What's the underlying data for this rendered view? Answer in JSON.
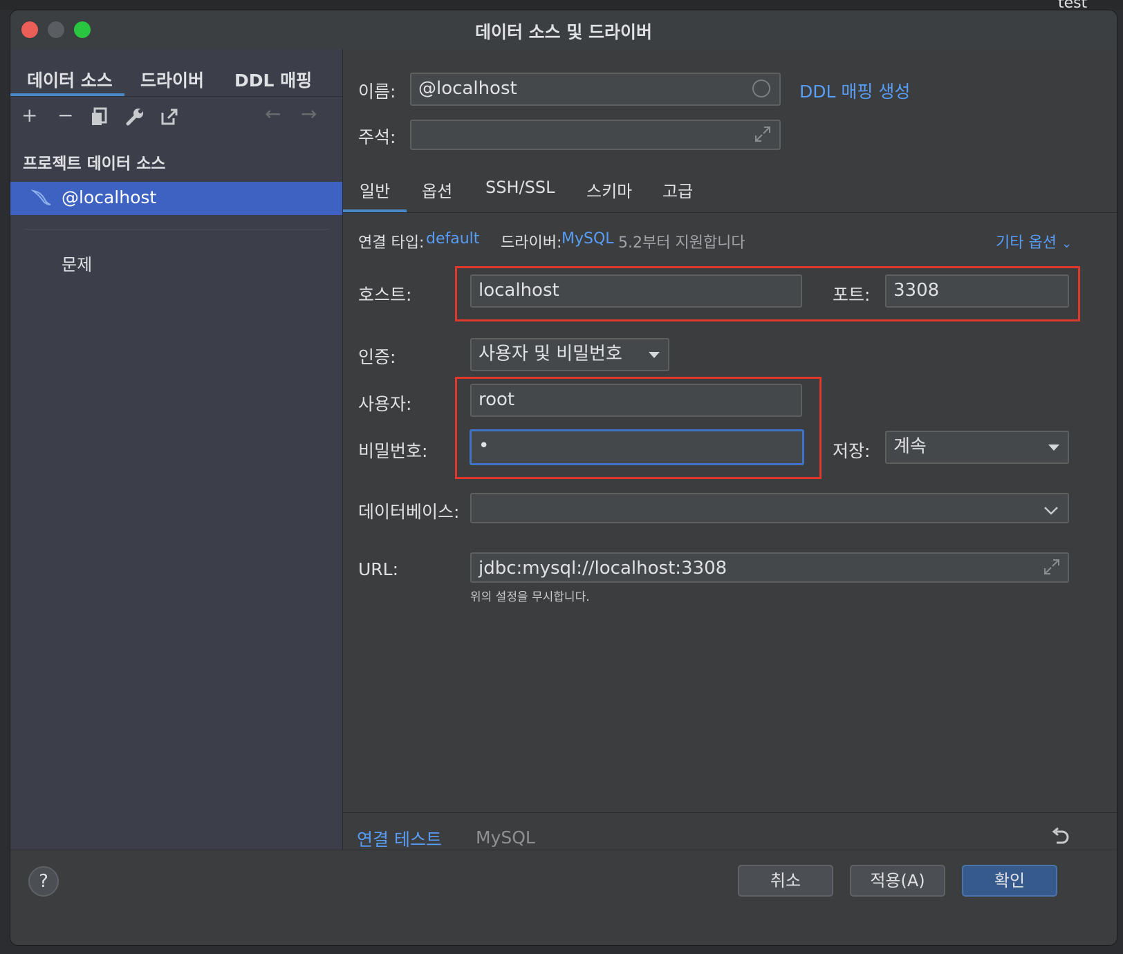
{
  "window": {
    "title": "데이터 소스 및 드라이버"
  },
  "background": {
    "right_label": "test"
  },
  "sidebar": {
    "tabs": [
      {
        "label": "데이터 소스",
        "active": true
      },
      {
        "label": "드라이버"
      },
      {
        "label": "DDL 매핑"
      }
    ],
    "section_title": "프로젝트 데이터 소스",
    "selected_item": "@localhost",
    "problems_label": "문제"
  },
  "form": {
    "name_label": "이름:",
    "name_value": "@localhost",
    "ddl_link": "DDL 매핑 생성",
    "comment_label": "주석:",
    "comment_value": ""
  },
  "tabs": [
    {
      "label": "일반",
      "active": true
    },
    {
      "label": "옵션"
    },
    {
      "label": "SSH/SSL"
    },
    {
      "label": "스키마"
    },
    {
      "label": "고급"
    }
  ],
  "connection": {
    "type_label": "연결 타입:",
    "type_value": "default",
    "driver_label": "드라이버:",
    "driver_value": "MySQL",
    "driver_note": "5.2부터 지원합니다",
    "more_options": "기타 옵션"
  },
  "fields": {
    "host_label": "호스트:",
    "host_value": "localhost",
    "port_label": "포트:",
    "port_value": "3308",
    "auth_label": "인증:",
    "auth_value": "사용자 및 비밀번호",
    "user_label": "사용자:",
    "user_value": "root",
    "password_label": "비밀번호:",
    "password_value": "•",
    "save_label": "저장:",
    "save_value": "계속",
    "database_label": "데이터베이스:",
    "database_value": "",
    "url_label": "URL:",
    "url_value": "jdbc:mysql://localhost:3308",
    "url_note": "위의 설정을 무시합니다."
  },
  "bottom": {
    "test_link": "연결 테스트",
    "driver_name": "MySQL"
  },
  "buttons": {
    "help": "?",
    "cancel": "취소",
    "apply": "적용(A)",
    "ok": "확인"
  },
  "colors": {
    "accent": "#589df6",
    "selection": "#3d62c2",
    "highlight_box": "#e0382a",
    "close": "#ec5f58",
    "minimize": "#5a5d61",
    "maximize": "#29c740"
  }
}
